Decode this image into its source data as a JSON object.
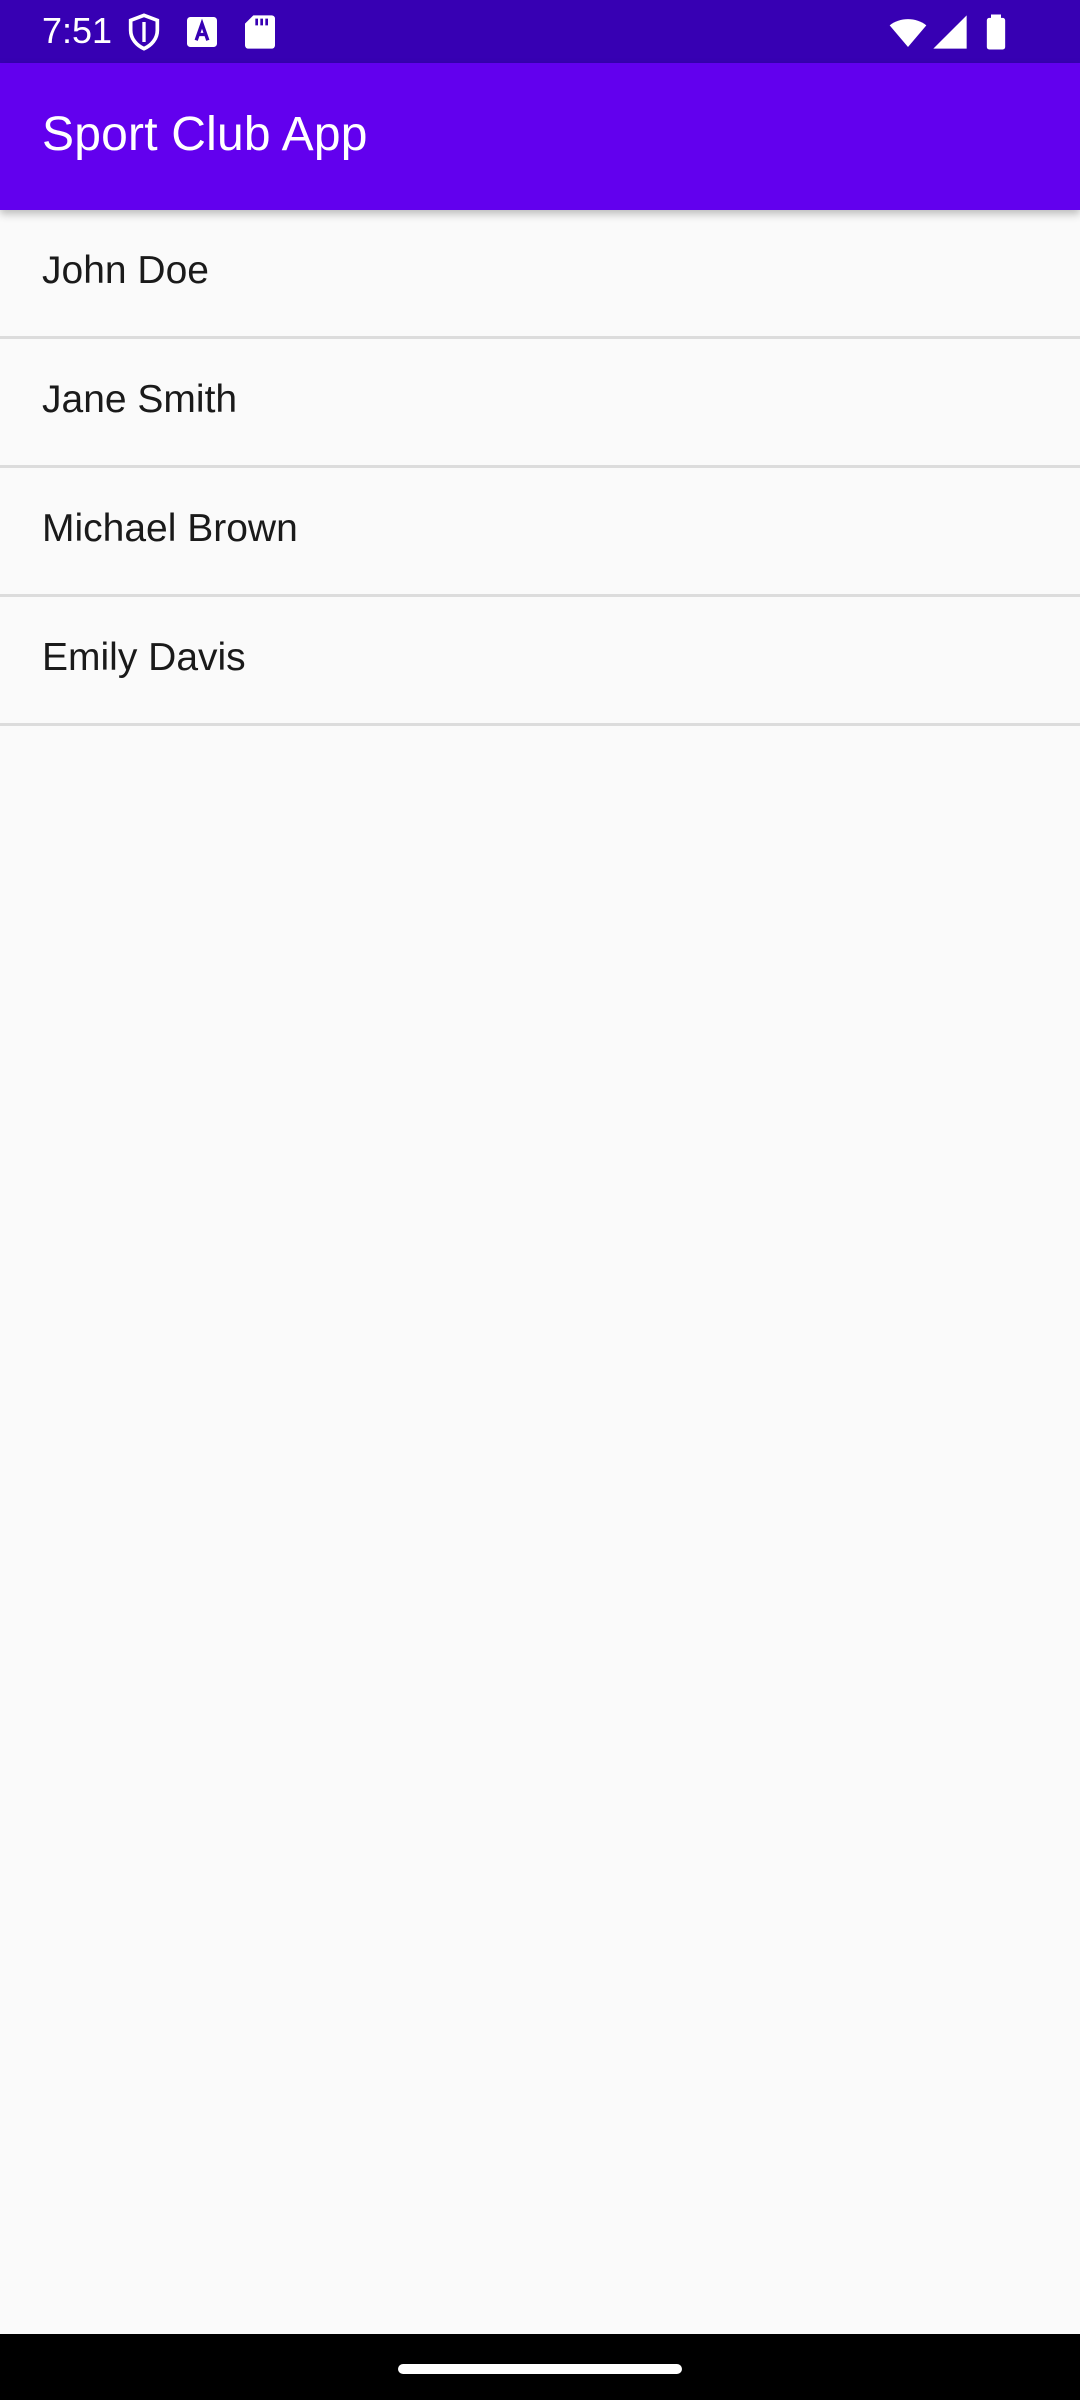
{
  "status_bar": {
    "time": "7:51",
    "background_color": "#3700b3",
    "left_icons": [
      "shield-icon",
      "font-a-icon",
      "sd-card-icon"
    ],
    "right_icons": [
      "wifi-icon",
      "cellular-signal-icon",
      "battery-icon"
    ]
  },
  "app_bar": {
    "title": "Sport Club App",
    "background_color": "#6200ee"
  },
  "members": [
    {
      "name": "John Doe"
    },
    {
      "name": "Jane Smith"
    },
    {
      "name": "Michael Brown"
    },
    {
      "name": "Emily Davis"
    }
  ],
  "nav_bar": {
    "handle_icon": "home-gesture-handle"
  }
}
